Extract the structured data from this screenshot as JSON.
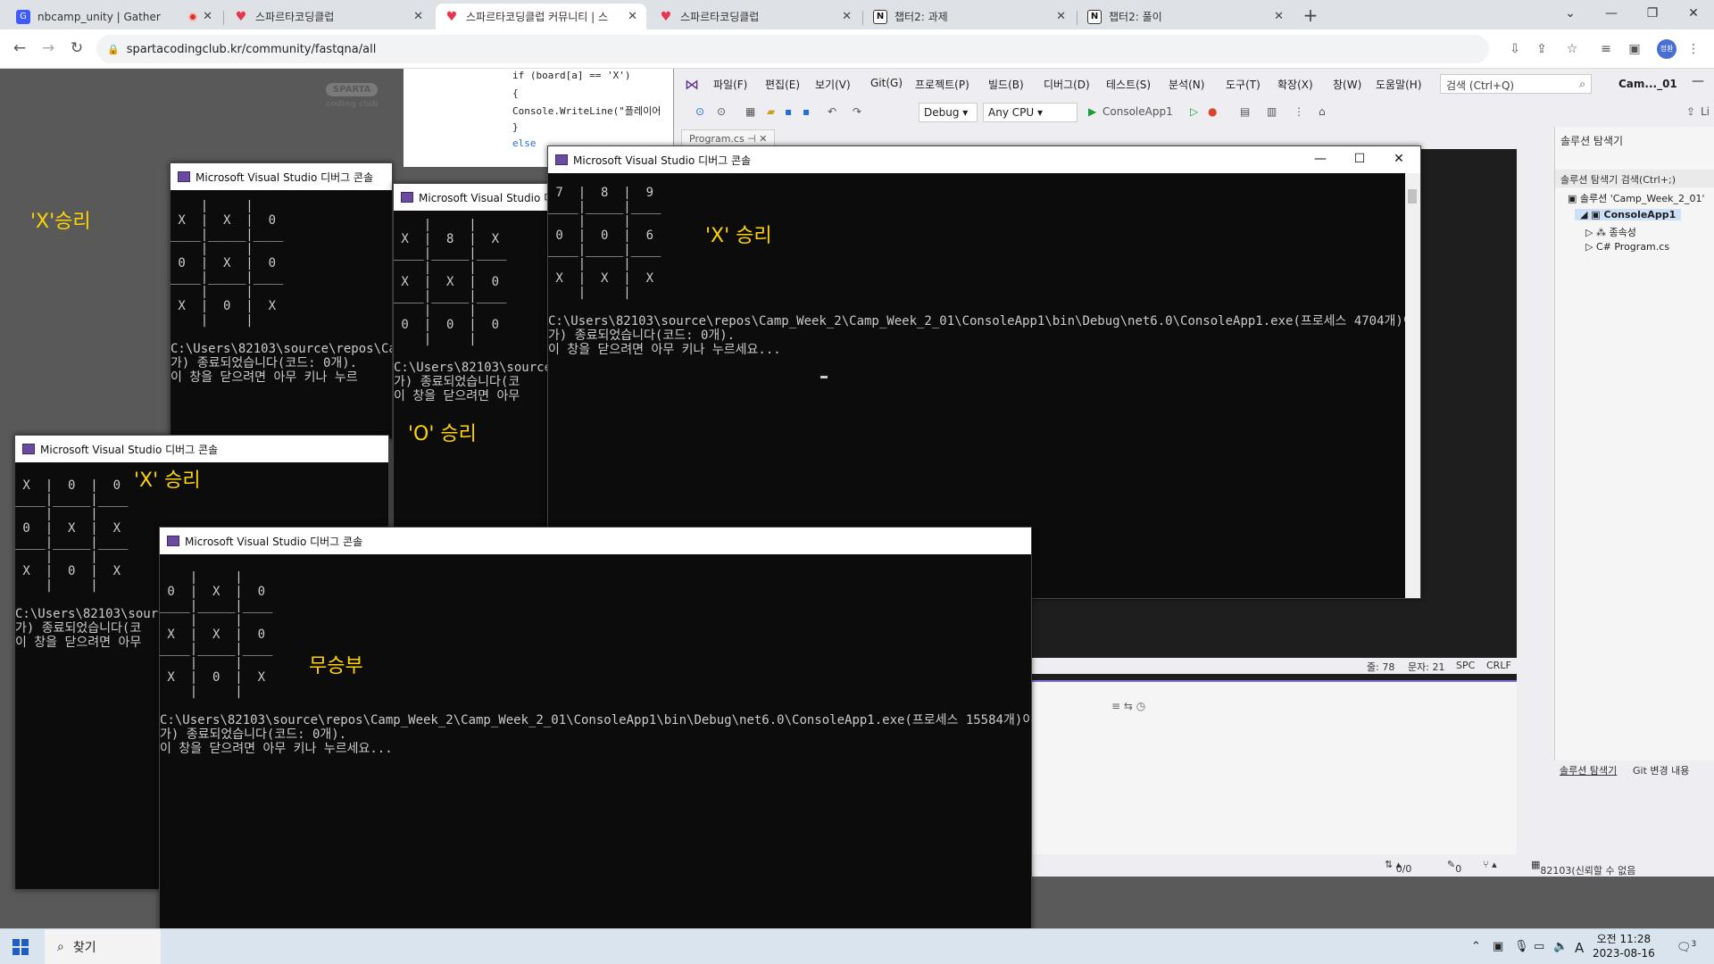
{
  "browser": {
    "tabs": [
      {
        "title": "nbcamp_unity | Gather",
        "icon": "gather-icon",
        "recording": true
      },
      {
        "title": "스파르타코딩클럽",
        "icon": "sparta-heart-icon"
      },
      {
        "title": "스파르타코딩클럽 커뮤니티 | 스",
        "icon": "sparta-heart-icon",
        "active": true
      },
      {
        "title": "스파르타코딩클럽",
        "icon": "sparta-heart-icon"
      },
      {
        "title": "챕터2: 과제",
        "icon": "notion-icon"
      },
      {
        "title": "챕터2: 풀이",
        "icon": "notion-icon"
      }
    ],
    "url": "spartacodingclub.kr/community/fastqna/all",
    "avatar_text": "정환"
  },
  "page": {
    "logo_text": "SPARTA",
    "logo_suffix": "coding club",
    "code_lines": [
      "if (board[a] == 'X')",
      "{",
      "    Console.WriteLine(\"플레이어",
      "}",
      "else"
    ]
  },
  "vs": {
    "menu": [
      "파일(F)",
      "편집(E)",
      "보기(V)",
      "Git(G)",
      "프로젝트(P)",
      "빌드(B)",
      "디버그(D)",
      "테스트(S)",
      "분석(N)",
      "도구(T)",
      "확장(X)",
      "창(W)",
      "도움말(H)"
    ],
    "search_placeholder": "검색 (Ctrl+Q)",
    "title": "Cam..._01",
    "config": "Debug",
    "platform": "Any CPU",
    "run_target": "ConsoleApp1",
    "doc_tab": "Program.cs",
    "live_share": "Li",
    "status": {
      "line": "줄: 78",
      "char": "문자: 21",
      "spc": "SPC",
      "crlf": "CRLF"
    },
    "solution_explorer": {
      "header": "솔루션 탐색기",
      "search": "솔루션 탐색기 검색(Ctrl+;)",
      "items": [
        "솔루션 'Camp_Week_2_01'",
        "ConsoleApp1",
        "종속성",
        "Program.cs"
      ],
      "bottom_tabs": [
        "솔루션 탐색기",
        "Git 변경 내용"
      ]
    },
    "bottom_bar": {
      "arrows": "0/0",
      "pencil": "0",
      "repo": "82103(신뢰할 수 없음"
    }
  },
  "consoles": [
    {
      "title": "Microsoft Visual Studio 디버그 콘솔",
      "lines": [
        " 7  |  8  |  9",
        "____|_____|____",
        "    |     |",
        " 0  |  0  |  6",
        "____|_____|____",
        "    |     |",
        " X  |  X  |  X",
        "    |     |",
        "",
        "C:\\Users\\82103\\source\\repos\\Camp_Week_2\\Camp_Week_2_01\\ConsoleApp1\\bin\\Debug\\net6.0\\ConsoleApp1.exe(프로세스 4704개)이(",
        "가) 종료되었습니다(코드: 0개).",
        "이 창을 닫으려면 아무 키나 누르세요..."
      ]
    },
    {
      "title": "Microsoft Visual Studio 디버그 콘솔",
      "lines": [
        "    |     |",
        " X  |  X  |  0",
        "____|_____|____",
        "    |     |",
        " 0  |  X  |  0",
        "____|_____|____",
        "    |     |",
        " X  |  0  |  X",
        "    |     |",
        "",
        "C:\\Users\\82103\\source\\repos\\Ca",
        "가) 종료되었습니다(코드: 0개).",
        "이 창을 닫으려면 아무 키나 누르"
      ]
    },
    {
      "title": "Microsoft Visual Studio 디",
      "lines": [
        "    |     |",
        " X  |  8  |  X",
        "____|_____|____",
        "    |     |",
        " X  |  X  |  0",
        "____|_____|____",
        "    |     |",
        " 0  |  0  |  0",
        "    |     |",
        "",
        "C:\\Users\\82103\\source\\",
        "가) 종료되었습니다(코",
        "이 창을 닫으려면 아무"
      ]
    },
    {
      "title": "Microsoft Visual Studio 디버그 콘솔",
      "lines": [
        " X  |  0  |  0",
        "____|_____|____",
        "    |     |",
        " 0  |  X  |  X",
        "____|_____|____",
        "    |     |",
        " X  |  0  |  X",
        "    |     |",
        "",
        "C:\\Users\\82103\\sourc",
        "가) 종료되었습니다(코",
        "이 창을 닫으려면 아무"
      ]
    },
    {
      "title": "Microsoft Visual Studio 디버그 콘솔",
      "lines": [
        "    |     |",
        " 0  |  X  |  0",
        "____|_____|____",
        "    |     |",
        " X  |  X  |  0",
        "____|_____|____",
        "    |     |",
        " X  |  0  |  X",
        "    |     |",
        "",
        "C:\\Users\\82103\\source\\repos\\Camp_Week_2\\Camp_Week_2_01\\ConsoleApp1\\bin\\Debug\\net6.0\\ConsoleApp1.exe(프로세스 15584개)이(",
        "가) 종료되었습니다(코드: 0개).",
        "이 창을 닫으려면 아무 키나 누르세요..."
      ]
    }
  ],
  "annotations": {
    "a1": "'X'승리",
    "a2": "'X' 승리",
    "a3": "'O' 승리",
    "a4": "'X' 승리",
    "a5": "무승부"
  },
  "taskbar": {
    "search": "찾기",
    "ime": "A",
    "time": "오전 11:28",
    "date": "2023-08-16",
    "notif_count": "3"
  },
  "colors": {
    "annotation": "#ffd500",
    "console_bg": "#0c0c0c",
    "console_text": "#cccccc",
    "vs_accent": "#7a6dd6"
  }
}
